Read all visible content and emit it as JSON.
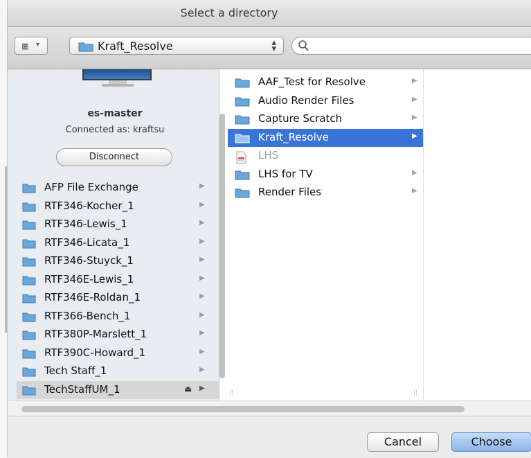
{
  "window": {
    "title": "Select a directory"
  },
  "toolbar": {
    "path_label": "Kraft_Resolve",
    "search": {
      "value": "",
      "placeholder": ""
    }
  },
  "sidebar": {
    "server_name": "es-master",
    "connected_as": "Connected as: kraftsu",
    "disconnect_label": "Disconnect",
    "volumes": [
      {
        "label": "AFP File Exchange"
      },
      {
        "label": "RTF346-Kocher_1"
      },
      {
        "label": "RTF346-Lewis_1"
      },
      {
        "label": "RTF346-Licata_1"
      },
      {
        "label": "RTF346-Stuyck_1"
      },
      {
        "label": "RTF346E-Lewis_1"
      },
      {
        "label": "RTF346E-Roldan_1"
      },
      {
        "label": "RTF366-Bench_1"
      },
      {
        "label": "RTF380P-Marslett_1"
      },
      {
        "label": "RTF390C-Howard_1"
      },
      {
        "label": "Tech Staff_1"
      },
      {
        "label": "TechStaffUM_1",
        "selected": true
      }
    ]
  },
  "column": {
    "items": [
      {
        "label": "AAF_Test for Resolve"
      },
      {
        "label": "Audio Render Files"
      },
      {
        "label": "Capture Scratch"
      },
      {
        "label": "Kraft_Resolve",
        "selected": true
      },
      {
        "label": "LHS",
        "disabled": true
      },
      {
        "label": "LHS for TV"
      },
      {
        "label": "Render Files"
      }
    ]
  },
  "buttons": {
    "cancel": "Cancel",
    "choose": "Choose"
  },
  "colors": {
    "selection": "#3875d7",
    "folder": "#6aa8db",
    "choose_button": "#8cb4ea"
  }
}
